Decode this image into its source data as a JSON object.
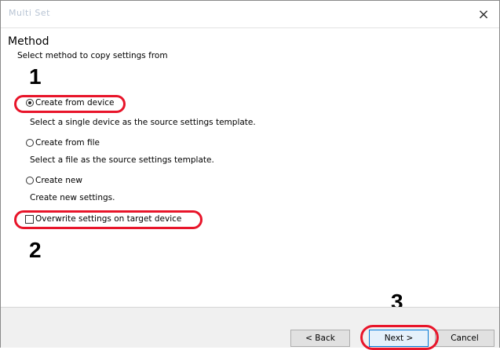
{
  "window": {
    "title": "Multi Set",
    "close_glyph": "×"
  },
  "header": {
    "title": "Method",
    "subtitle": "Select method to copy settings from"
  },
  "options": [
    {
      "label": "Create from device",
      "description": "Select a single device as the source settings template.",
      "checked": true
    },
    {
      "label": "Create from file",
      "description": "Select a file as the source settings template.",
      "checked": false
    },
    {
      "label": "Create new",
      "description": "Create new settings.",
      "checked": false
    }
  ],
  "overwrite": {
    "label": "Overwrite settings on target device",
    "checked": false
  },
  "steps": [
    "1",
    "2",
    "3"
  ],
  "buttons": {
    "back": "< Back",
    "next": "Next >",
    "cancel": "Cancel"
  },
  "colors": {
    "highlight": "#e8152a",
    "default_button_border": "#0078d7",
    "footer_bg": "#f0f0f0"
  }
}
